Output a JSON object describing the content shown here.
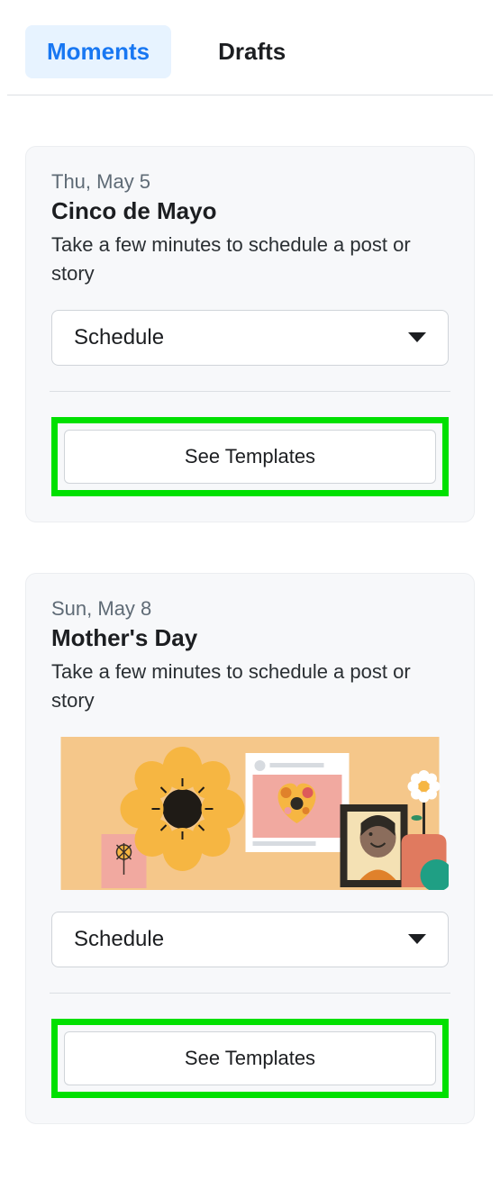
{
  "tabs": [
    {
      "label": "Moments",
      "active": true
    },
    {
      "label": "Drafts",
      "active": false
    }
  ],
  "schedule_dropdown_label": "Schedule",
  "see_templates_label": "See Templates",
  "cards": [
    {
      "date": "Thu, May 5",
      "title": "Cinco de Mayo",
      "description": "Take a few minutes to schedule a post or story"
    },
    {
      "date": "Sun, May 8",
      "title": "Mother's Day",
      "description": "Take a few minutes to schedule a post or story"
    }
  ]
}
